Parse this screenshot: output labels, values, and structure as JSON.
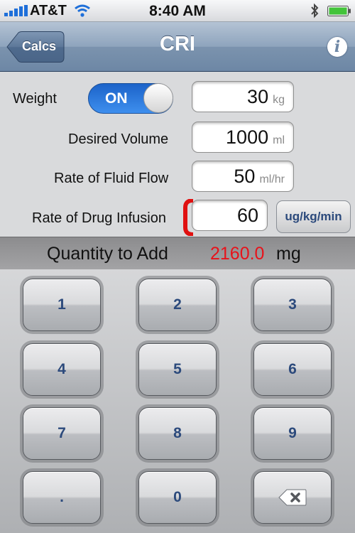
{
  "status": {
    "carrier": "AT&T",
    "time": "8:40 AM",
    "icons": [
      "signal-bars-icon",
      "wifi-icon",
      "bluetooth-icon",
      "battery-icon"
    ]
  },
  "nav": {
    "back_label": "Calcs",
    "title": "CRI",
    "info_label": "i"
  },
  "form": {
    "weight": {
      "label": "Weight",
      "toggle": "ON",
      "value": "30",
      "unit": "kg"
    },
    "desired_volume": {
      "label": "Desired Volume",
      "value": "1000",
      "unit": "ml"
    },
    "fluid_flow": {
      "label": "Rate of Fluid Flow",
      "value": "50",
      "unit": "ml/hr"
    },
    "drug_infusion": {
      "label": "Rate of Drug Infusion",
      "value": "60",
      "unit_button": "ug/kg/min"
    }
  },
  "result": {
    "label": "Quantity to Add",
    "value": "2160.0",
    "unit": "mg"
  },
  "keypad": {
    "keys": [
      "1",
      "2",
      "3",
      "4",
      "5",
      "6",
      "7",
      "8",
      "9",
      ".",
      "0"
    ],
    "delete_icon": "backspace-icon"
  },
  "colors": {
    "nav_bar": "#7b93ae",
    "toggle_on": "#2a74dc",
    "result_value": "#e8121a",
    "key_text": "#2c4a7c",
    "focus_marker": "#e01010"
  }
}
